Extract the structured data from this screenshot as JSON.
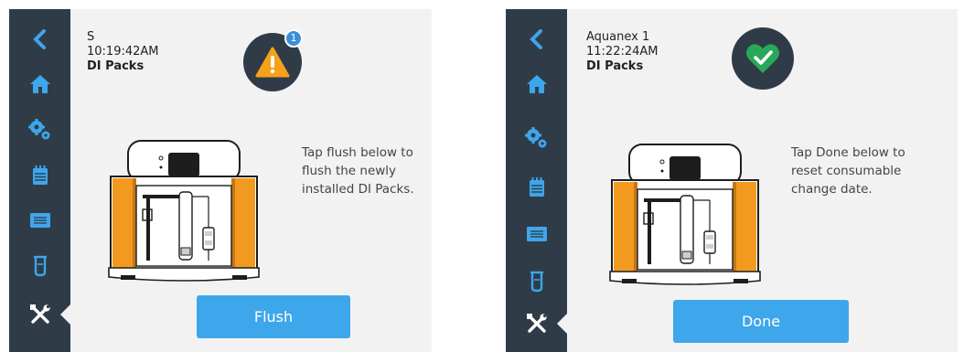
{
  "left": {
    "device_name": "S",
    "time": "10:19:42AM",
    "section": "DI Packs",
    "status": "warning",
    "badge_count": "1",
    "instructions": [
      "Tap flush below to",
      "flush the newly",
      "installed DI Packs."
    ],
    "button_label": "Flush"
  },
  "right": {
    "device_name": "Aquanex 1",
    "time": "11:22:24AM",
    "section": "DI Packs",
    "status": "ok",
    "instructions": [
      "Tap Done below to",
      "reset consumable",
      "change date."
    ],
    "button_label": "Done"
  },
  "sidebar_items": [
    "back-icon",
    "home-icon",
    "settings-gears-icon",
    "calendar-icon",
    "display-panel-icon",
    "beaker-icon",
    "tools-icon"
  ],
  "colors": {
    "sidebar": "#2f3c48",
    "accent": "#3ea6ea",
    "warning": "#f7a11a",
    "ok": "#2aa85a",
    "machine_side": "#f29a1f"
  }
}
